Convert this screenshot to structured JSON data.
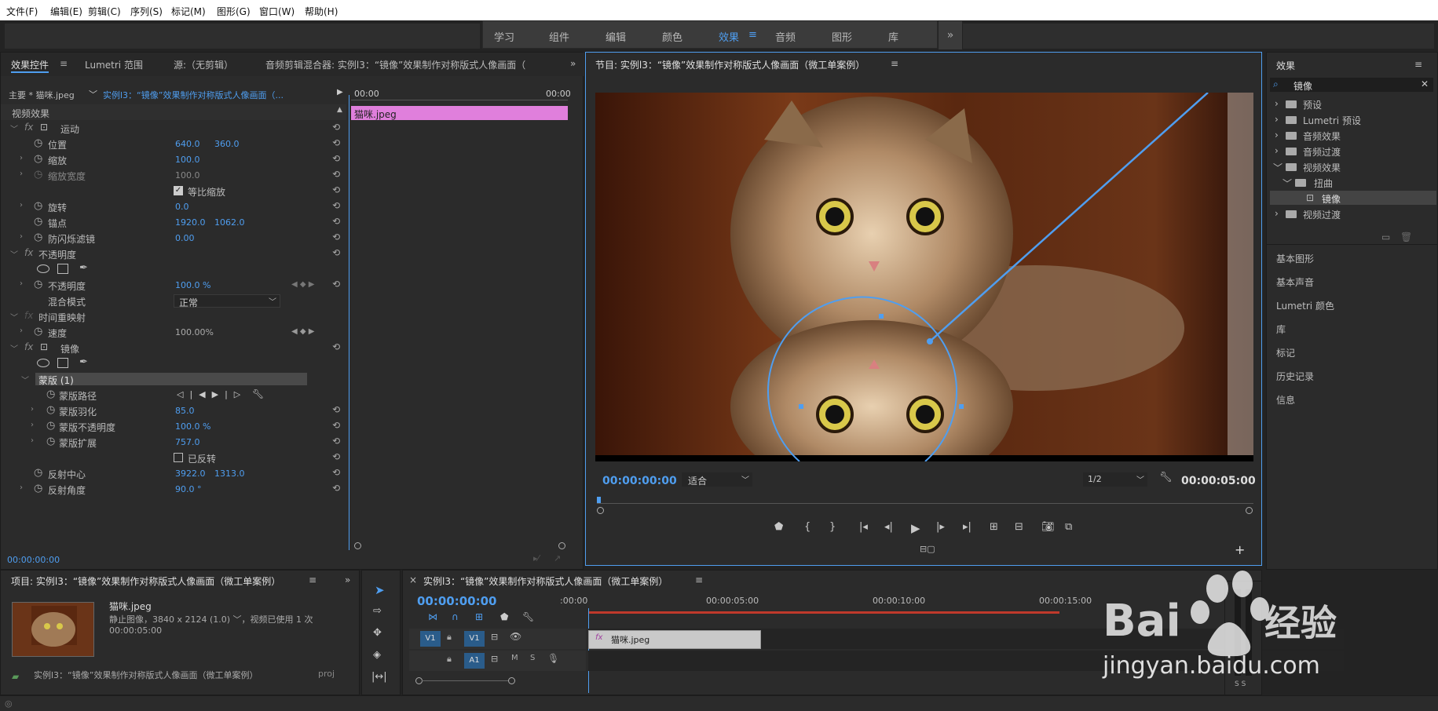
{
  "menu": [
    "文件(F)",
    "编辑(E)",
    "剪辑(C)",
    "序列(S)",
    "标记(M)",
    "图形(G)",
    "窗口(W)",
    "帮助(H)"
  ],
  "workspaces": [
    "学习",
    "组件",
    "编辑",
    "颜色",
    "效果",
    "音频",
    "图形",
    "库"
  ],
  "active_workspace": "效果",
  "effect_controls": {
    "tabs": [
      "效果控件",
      "Lumetri 范围",
      "源:（无剪辑）",
      "音频剪辑混合器: 实例l3：“镜像”效果制作对称版式人像画面（"
    ],
    "master": "主要 * 猫咪.jpeg",
    "sequence": "实例l3：“镜像”效果制作对称版式人像画面（...",
    "time_start": "00:00",
    "time_end": "00:00",
    "clip_name": "猫咪.jpeg",
    "section_video": "视频效果",
    "rows": {
      "motion": "运动",
      "position": "位置",
      "position_x": "640.0",
      "position_y": "360.0",
      "scale": "缩放",
      "scale_v": "100.0",
      "scale_width": "缩放宽度",
      "scale_width_v": "100.0",
      "uniform_scale": "等比缩放",
      "rotation": "旋转",
      "rotation_v": "0.0",
      "anchor": "锚点",
      "anchor_x": "1920.0",
      "anchor_y": "1062.0",
      "antiflicker": "防闪烁滤镜",
      "antiflicker_v": "0.00",
      "opacity_group": "不透明度",
      "opacity": "不透明度",
      "opacity_v": "100.0 %",
      "blend_mode": "混合模式",
      "blend_mode_v": "正常",
      "time_remap": "时间重映射",
      "speed": "速度",
      "speed_v": "100.00%",
      "mirror": "镜像",
      "mask": "蒙版 (1)",
      "mask_path": "蒙版路径",
      "mask_feather": "蒙版羽化",
      "mask_feather_v": "85.0",
      "mask_opacity": "蒙版不透明度",
      "mask_opacity_v": "100.0 %",
      "mask_expansion": "蒙版扩展",
      "mask_expansion_v": "757.0",
      "inverted": "已反转",
      "reflect_center": "反射中心",
      "reflect_center_x": "3922.0",
      "reflect_center_y": "1313.0",
      "reflect_angle": "反射角度",
      "reflect_angle_v": "90.0 °"
    },
    "timecode": "00:00:00:00"
  },
  "program": {
    "title": "节目: 实例l3：“镜像”效果制作对称版式人像画面（微工单案例）",
    "timecode": "00:00:00:00",
    "fit": "适合",
    "resolution": "1/2",
    "duration": "00:00:05:00"
  },
  "effects_panel": {
    "title": "效果",
    "search": "镜像",
    "tree": [
      "预设",
      "Lumetri 预设",
      "音频效果",
      "音频过渡",
      "视频效果",
      "扭曲",
      "镜像",
      "视频过渡"
    ],
    "sections": [
      "基本图形",
      "基本声音",
      "Lumetri 颜色",
      "库",
      "标记",
      "历史记录",
      "信息"
    ]
  },
  "project": {
    "title": "项目: 实例l3：“镜像”效果制作对称版式人像画面（微工单案例）",
    "file": "猫咪.jpeg",
    "info": "静止图像，3840 x 2124 (1.0) ﹀，视频已使用 1 次",
    "duration": "00:00:05:00",
    "item1": "实例l3：“镜像”效果制作对称版式人像画面（微工单案例）",
    "item2": "proj"
  },
  "timeline": {
    "title": "实例l3：“镜像”效果制作对称版式人像画面（微工单案例）",
    "timecode": "00:00:00:00",
    "ruler": [
      ":00:00",
      "00:00:05:00",
      "00:00:10:00",
      "00:00:15:00"
    ],
    "tracks": [
      "V1",
      "A1"
    ],
    "clip": "猫咪.jpeg",
    "track_m": "M",
    "track_s": "S"
  },
  "watermark": "jingyan.baidu.com",
  "colors": {
    "accent": "#4f9ef0",
    "clip": "#e07fdc",
    "bg": "#232323",
    "panel": "#2b2b2b"
  }
}
